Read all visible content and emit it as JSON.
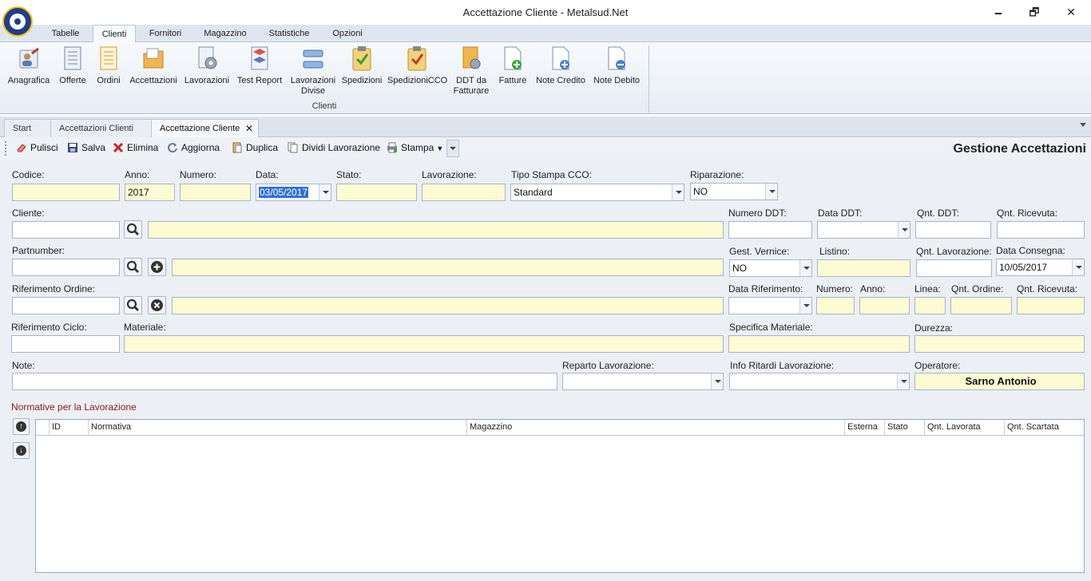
{
  "window": {
    "title": "Accettazione Cliente - Metalsud.Net",
    "minimize": "🗕",
    "restore": "🗗",
    "close": "✕"
  },
  "ribbon_tabs": [
    "Tabelle",
    "Clienti",
    "Fornitori",
    "Magazzino",
    "Statistiche",
    "Opzioni"
  ],
  "ribbon": {
    "group_label": "Clienti",
    "buttons": [
      {
        "label": "Anagrafica",
        "icon": "user-card-icon"
      },
      {
        "label": "Offerte",
        "icon": "document-list-icon"
      },
      {
        "label": "Ordini",
        "icon": "orders-icon"
      },
      {
        "label": "Accettazioni",
        "icon": "folder-icon"
      },
      {
        "label": "Lavorazioni",
        "icon": "gear-document-icon"
      },
      {
        "label": "Test Report",
        "icon": "report-icon"
      },
      {
        "label": "Lavorazioni Divise",
        "icon": "split-icon"
      },
      {
        "label": "Spedizioni",
        "icon": "clipboard-check-icon"
      },
      {
        "label": "SpedizioniCCO",
        "icon": "clipboard-check-icon"
      },
      {
        "label": "DDT da Fatturare",
        "icon": "ddt-gear-icon"
      },
      {
        "label": "Fatture",
        "icon": "invoice-add-icon"
      },
      {
        "label": "Note Credito",
        "icon": "credit-note-icon"
      },
      {
        "label": "Note Debito",
        "icon": "debit-note-icon"
      }
    ]
  },
  "doc_tabs": [
    "Start",
    "Accettazioni Clienti",
    "Accettazione Cliente"
  ],
  "toolbar": {
    "pulisci": "Pulisci",
    "salva": "Salva",
    "elimina": "Elimina",
    "aggiorna": "Aggiorna",
    "duplica": "Duplica",
    "dividi": "Dividi Lavorazione",
    "stampa": "Stampa",
    "heading": "Gestione Accettazioni"
  },
  "form": {
    "codice": {
      "label": "Codice:",
      "value": ""
    },
    "anno": {
      "label": "Anno:",
      "value": "2017"
    },
    "numero": {
      "label": "Numero:",
      "value": ""
    },
    "data": {
      "label": "Data:",
      "value": "03/05/2017"
    },
    "stato": {
      "label": "Stato:",
      "value": ""
    },
    "lavorazione": {
      "label": "Lavorazione:",
      "value": ""
    },
    "tipo_stampa": {
      "label": "Tipo Stampa CCO:",
      "value": "Standard"
    },
    "riparazione": {
      "label": "Riparazione:",
      "value": "NO"
    },
    "cliente": {
      "label": "Cliente:",
      "value": ""
    },
    "numero_ddt": {
      "label": "Numero DDT:",
      "value": ""
    },
    "data_ddt": {
      "label": "Data DDT:",
      "value": ""
    },
    "qnt_ddt": {
      "label": "Qnt. DDT:",
      "value": ""
    },
    "qnt_ricevuta": {
      "label": "Qnt. Ricevuta:",
      "value": ""
    },
    "partnumber": {
      "label": "Partnumber:",
      "value": ""
    },
    "gest_vernice": {
      "label": "Gest. Vernice:",
      "value": "NO"
    },
    "listino": {
      "label": "Listino:",
      "value": ""
    },
    "qnt_lavorazione": {
      "label": "Qnt. Lavorazione:",
      "value": ""
    },
    "data_consegna": {
      "label": "Data Consegna:",
      "value": "10/05/2017"
    },
    "rif_ordine": {
      "label": "Riferimento Ordine:",
      "value": ""
    },
    "data_riferimento": {
      "label": "Data Riferimento:",
      "value": ""
    },
    "rif_numero": {
      "label": "Numero:",
      "value": ""
    },
    "rif_anno": {
      "label": "Anno:",
      "value": ""
    },
    "linea": {
      "label": "Linea:",
      "value": ""
    },
    "qnt_ordine": {
      "label": "Qnt. Ordine:",
      "value": ""
    },
    "qnt_ricevuta2": {
      "label": "Qnt. Ricevuta:",
      "value": ""
    },
    "rif_ciclo": {
      "label": "Riferimento Ciclo:",
      "value": ""
    },
    "materiale": {
      "label": "Materiale:",
      "value": ""
    },
    "specifica": {
      "label": "Specifica Materiale:",
      "value": ""
    },
    "durezza": {
      "label": "Durezza:",
      "value": ""
    },
    "note": {
      "label": "Note:",
      "value": ""
    },
    "reparto": {
      "label": "Reparto Lavorazione:",
      "value": ""
    },
    "info_ritardi": {
      "label": "Info Ritardi Lavorazione:",
      "value": ""
    },
    "operatore": {
      "label": "Operatore:",
      "value": "Sarno Antonio"
    }
  },
  "normative": {
    "title": "Normative per la Lavorazione",
    "columns": [
      "ID",
      "Normativa",
      "Magazzino",
      "Esterna",
      "Stato",
      "Qnt. Lavorata",
      "Qnt. Scartata"
    ]
  },
  "colors": {
    "accent": "#3170d6",
    "yellow_field": "#fdfbd3",
    "section_title": "#8b1a1a"
  }
}
